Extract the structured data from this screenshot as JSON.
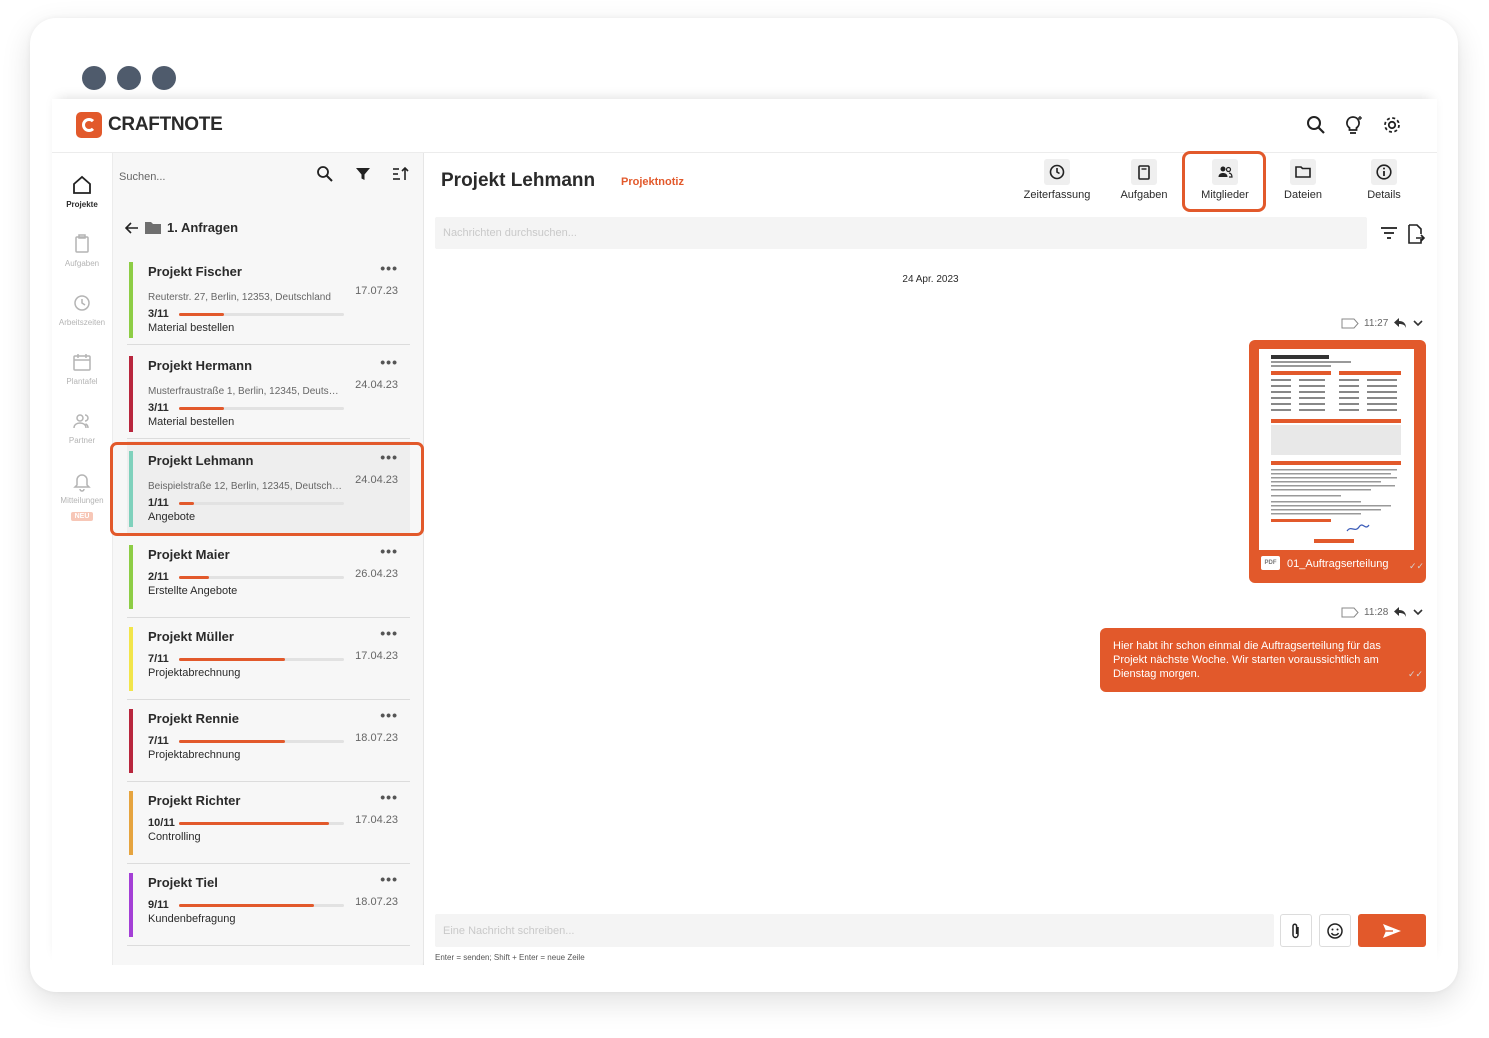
{
  "brand": {
    "name": "CRAFTNOTE",
    "accent": "#e2592b"
  },
  "nav": {
    "items": [
      {
        "label": "Projekte",
        "icon": "home-icon"
      },
      {
        "label": "Aufgaben",
        "icon": "clipboard-icon"
      },
      {
        "label": "Arbeitszeiten",
        "icon": "clock-icon"
      },
      {
        "label": "Plantafel",
        "icon": "calendar-icon"
      },
      {
        "label": "Partner",
        "icon": "people-icon"
      },
      {
        "label": "Mitteilungen",
        "icon": "bell-icon",
        "badge": "NEU"
      }
    ]
  },
  "list": {
    "search_placeholder": "Suchen...",
    "folder": "1. Anfragen",
    "projects": [
      {
        "title": "Projekt Fischer",
        "date": "17.07.23",
        "address": "Reuterstr. 27, Berlin, 12353, Deutschland",
        "count": "3/11",
        "progress": 0.27,
        "status": "Material bestellen",
        "color": "#8dcd45"
      },
      {
        "title": "Projekt Hermann",
        "date": "24.04.23",
        "address": "Musterfraustraße 1, Berlin, 12345, Deutschland",
        "count": "3/11",
        "progress": 0.27,
        "status": "Material bestellen",
        "color": "#b8263d"
      },
      {
        "title": "Projekt Lehmann",
        "date": "24.04.23",
        "address": "Beispielstraße 12, Berlin, 12345, Deutschland",
        "count": "1/11",
        "progress": 0.09,
        "status": "Angebote",
        "color": "#7fd1bc"
      },
      {
        "title": "Projekt Maier",
        "date": "26.04.23",
        "address": "",
        "count": "2/11",
        "progress": 0.18,
        "status": "Erstellte Angebote",
        "color": "#8dcd45"
      },
      {
        "title": "Projekt Müller",
        "date": "17.04.23",
        "address": "",
        "count": "7/11",
        "progress": 0.64,
        "status": "Projektabrechnung",
        "color": "#f2e54a"
      },
      {
        "title": "Projekt Rennie",
        "date": "18.07.23",
        "address": "",
        "count": "7/11",
        "progress": 0.64,
        "status": "Projektabrechnung",
        "color": "#b8263d"
      },
      {
        "title": "Projekt Richter",
        "date": "17.04.23",
        "address": "",
        "count": "10/11",
        "progress": 0.91,
        "status": "Controlling",
        "color": "#e6a43f"
      },
      {
        "title": "Projekt Tiel",
        "date": "18.07.23",
        "address": "",
        "count": "9/11",
        "progress": 0.82,
        "status": "Kundenbefragung",
        "color": "#a43fd6"
      }
    ],
    "add_label": "+"
  },
  "chat": {
    "title": "Projekt Lehmann",
    "subtitle": "Projektnotiz",
    "tabs": [
      {
        "label": "Zeiterfassung",
        "icon": "clock-icon"
      },
      {
        "label": "Aufgaben",
        "icon": "clipboard-icon"
      },
      {
        "label": "Mitglieder",
        "icon": "members-icon"
      },
      {
        "label": "Dateien",
        "icon": "folder-icon"
      },
      {
        "label": "Details",
        "icon": "info-icon"
      }
    ],
    "search_placeholder": "Nachrichten durchsuchen...",
    "date_separator": "24 Apr. 2023",
    "messages": [
      {
        "time": "11:27",
        "type": "file",
        "file_name": "01_Auftragserteilung",
        "badge": "PDF"
      },
      {
        "time": "11:28",
        "type": "text",
        "text": "Hier habt ihr schon einmal die Auftragserteilung für das Projekt nächste Woche. Wir starten voraussichtlich am Dienstag morgen."
      }
    ],
    "composer_placeholder": "Eine Nachricht schreiben...",
    "hint": "Enter = senden; Shift + Enter = neue Zeile"
  }
}
